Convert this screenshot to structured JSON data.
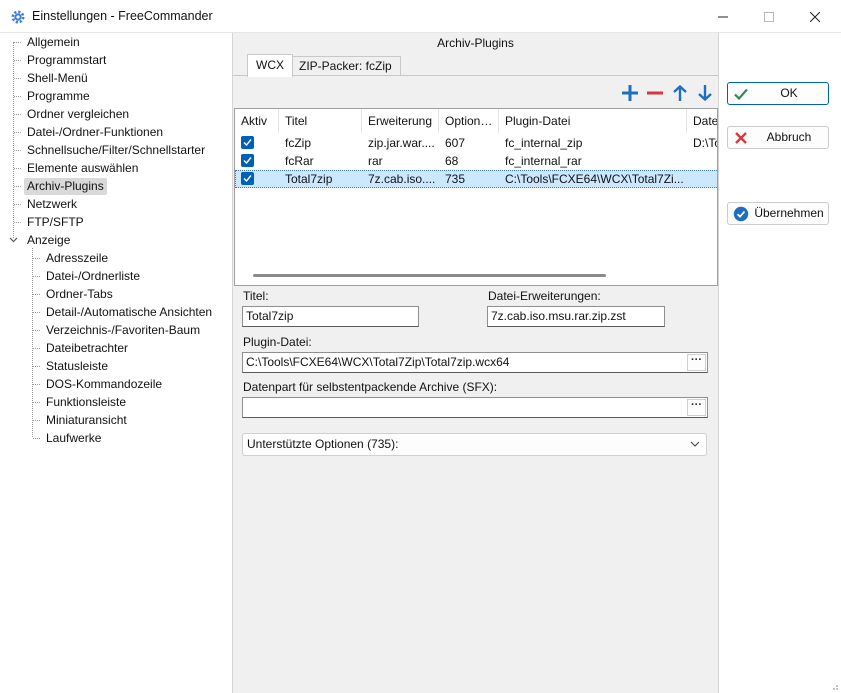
{
  "window": {
    "title": "Einstellungen - FreeCommander",
    "min_icon": "minimize-icon",
    "max_icon": "maximize-icon",
    "close_icon": "close-icon"
  },
  "tree": {
    "items": [
      {
        "label": "Allgemein"
      },
      {
        "label": "Programmstart"
      },
      {
        "label": "Shell-Menü"
      },
      {
        "label": "Programme"
      },
      {
        "label": "Ordner vergleichen"
      },
      {
        "label": "Datei-/Ordner-Funktionen"
      },
      {
        "label": "Schnellsuche/Filter/Schnellstarter"
      },
      {
        "label": "Elemente auswählen"
      },
      {
        "label": "Archiv-Plugins",
        "selected": true
      },
      {
        "label": "Netzwerk"
      },
      {
        "label": "FTP/SFTP"
      },
      {
        "label": "Anzeige",
        "expanded": true
      }
    ],
    "children": [
      {
        "label": "Adresszeile"
      },
      {
        "label": "Datei-/Ordnerliste"
      },
      {
        "label": "Ordner-Tabs"
      },
      {
        "label": "Detail-/Automatische Ansichten"
      },
      {
        "label": "Verzeichnis-/Favoriten-Baum"
      },
      {
        "label": "Dateibetrachter"
      },
      {
        "label": "Statusleiste"
      },
      {
        "label": "DOS-Kommandozeile"
      },
      {
        "label": "Funktionsleiste"
      },
      {
        "label": "Miniaturansicht"
      },
      {
        "label": "Laufwerke"
      }
    ]
  },
  "page": {
    "header": "Archiv-Plugins",
    "tabs": [
      {
        "label": "WCX",
        "active": true
      },
      {
        "label": "ZIP-Packer: fcZip",
        "active": false
      }
    ],
    "toolbar": {
      "add_icon": "plus-icon",
      "remove_icon": "minus-icon",
      "up_icon": "arrow-up-icon",
      "down_icon": "arrow-down-icon",
      "colors": {
        "add": "#1f6fc1",
        "remove": "#d9363e",
        "arrows": "#1f6fc1"
      }
    },
    "list": {
      "columns": [
        "Aktiv",
        "Titel",
        "Erweiterung",
        "Option…",
        "Plugin-Datei",
        "Date"
      ],
      "rows": [
        {
          "active": true,
          "title": "fcZip",
          "ext": "zip.jar.war....",
          "opt": "607",
          "file": "fc_internal_zip",
          "date": "D:\\To"
        },
        {
          "active": true,
          "title": "fcRar",
          "ext": "rar",
          "opt": "68",
          "file": "fc_internal_rar",
          "date": ""
        },
        {
          "active": true,
          "title": "Total7zip",
          "ext": "7z.cab.iso....",
          "opt": "735",
          "file": "C:\\Tools\\FCXE64\\WCX\\Total7Zi...",
          "date": "",
          "selected": true
        }
      ]
    },
    "form": {
      "title_label": "Titel:",
      "title_value": "Total7zip",
      "ext_label": "Datei-Erweiterungen:",
      "ext_value": "7z.cab.iso.msu.rar.zip.zst",
      "plugin_label": "Plugin-Datei:",
      "plugin_value": "C:\\Tools\\FCXE64\\WCX\\Total7Zip\\Total7zip.wcx64",
      "sfx_label": "Datenpart für selbstentpackende Archive (SFX):",
      "sfx_value": "",
      "browse_label": "···",
      "options_label": "Unterstützte Optionen (735):"
    }
  },
  "buttons": {
    "ok": "OK",
    "cancel": "Abbruch",
    "apply": "Übernehmen",
    "colors": {
      "ok_check": "#2e8b57",
      "cancel_x": "#d9363e",
      "apply_circle": "#1f6fc1",
      "default_border": "#005fb8"
    }
  }
}
